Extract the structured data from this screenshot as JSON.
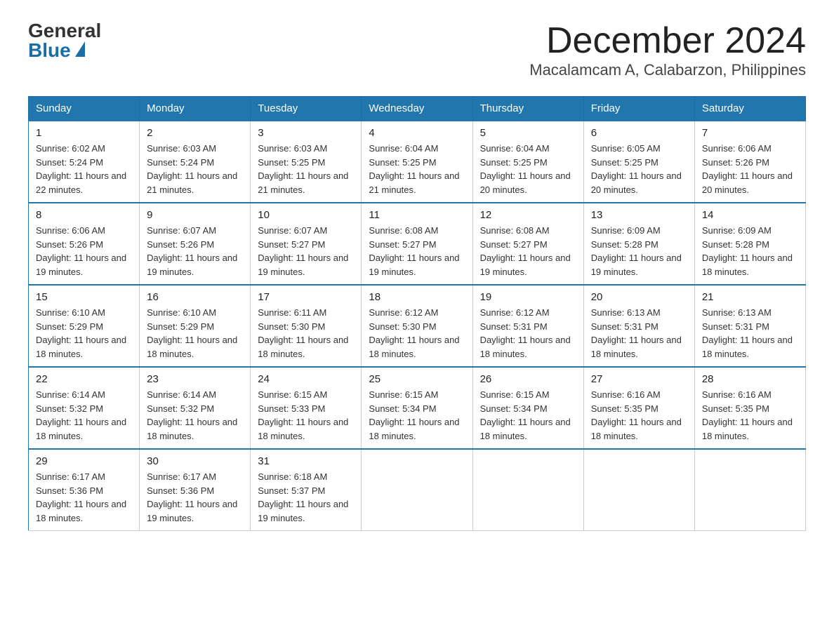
{
  "header": {
    "logo_general": "General",
    "logo_blue": "Blue",
    "month_title": "December 2024",
    "location": "Macalamcam A, Calabarzon, Philippines"
  },
  "weekdays": [
    "Sunday",
    "Monday",
    "Tuesday",
    "Wednesday",
    "Thursday",
    "Friday",
    "Saturday"
  ],
  "weeks": [
    [
      {
        "day": "1",
        "sunrise": "6:02 AM",
        "sunset": "5:24 PM",
        "daylight": "11 hours and 22 minutes."
      },
      {
        "day": "2",
        "sunrise": "6:03 AM",
        "sunset": "5:24 PM",
        "daylight": "11 hours and 21 minutes."
      },
      {
        "day": "3",
        "sunrise": "6:03 AM",
        "sunset": "5:25 PM",
        "daylight": "11 hours and 21 minutes."
      },
      {
        "day": "4",
        "sunrise": "6:04 AM",
        "sunset": "5:25 PM",
        "daylight": "11 hours and 21 minutes."
      },
      {
        "day": "5",
        "sunrise": "6:04 AM",
        "sunset": "5:25 PM",
        "daylight": "11 hours and 20 minutes."
      },
      {
        "day": "6",
        "sunrise": "6:05 AM",
        "sunset": "5:25 PM",
        "daylight": "11 hours and 20 minutes."
      },
      {
        "day": "7",
        "sunrise": "6:06 AM",
        "sunset": "5:26 PM",
        "daylight": "11 hours and 20 minutes."
      }
    ],
    [
      {
        "day": "8",
        "sunrise": "6:06 AM",
        "sunset": "5:26 PM",
        "daylight": "11 hours and 19 minutes."
      },
      {
        "day": "9",
        "sunrise": "6:07 AM",
        "sunset": "5:26 PM",
        "daylight": "11 hours and 19 minutes."
      },
      {
        "day": "10",
        "sunrise": "6:07 AM",
        "sunset": "5:27 PM",
        "daylight": "11 hours and 19 minutes."
      },
      {
        "day": "11",
        "sunrise": "6:08 AM",
        "sunset": "5:27 PM",
        "daylight": "11 hours and 19 minutes."
      },
      {
        "day": "12",
        "sunrise": "6:08 AM",
        "sunset": "5:27 PM",
        "daylight": "11 hours and 19 minutes."
      },
      {
        "day": "13",
        "sunrise": "6:09 AM",
        "sunset": "5:28 PM",
        "daylight": "11 hours and 19 minutes."
      },
      {
        "day": "14",
        "sunrise": "6:09 AM",
        "sunset": "5:28 PM",
        "daylight": "11 hours and 18 minutes."
      }
    ],
    [
      {
        "day": "15",
        "sunrise": "6:10 AM",
        "sunset": "5:29 PM",
        "daylight": "11 hours and 18 minutes."
      },
      {
        "day": "16",
        "sunrise": "6:10 AM",
        "sunset": "5:29 PM",
        "daylight": "11 hours and 18 minutes."
      },
      {
        "day": "17",
        "sunrise": "6:11 AM",
        "sunset": "5:30 PM",
        "daylight": "11 hours and 18 minutes."
      },
      {
        "day": "18",
        "sunrise": "6:12 AM",
        "sunset": "5:30 PM",
        "daylight": "11 hours and 18 minutes."
      },
      {
        "day": "19",
        "sunrise": "6:12 AM",
        "sunset": "5:31 PM",
        "daylight": "11 hours and 18 minutes."
      },
      {
        "day": "20",
        "sunrise": "6:13 AM",
        "sunset": "5:31 PM",
        "daylight": "11 hours and 18 minutes."
      },
      {
        "day": "21",
        "sunrise": "6:13 AM",
        "sunset": "5:31 PM",
        "daylight": "11 hours and 18 minutes."
      }
    ],
    [
      {
        "day": "22",
        "sunrise": "6:14 AM",
        "sunset": "5:32 PM",
        "daylight": "11 hours and 18 minutes."
      },
      {
        "day": "23",
        "sunrise": "6:14 AM",
        "sunset": "5:32 PM",
        "daylight": "11 hours and 18 minutes."
      },
      {
        "day": "24",
        "sunrise": "6:15 AM",
        "sunset": "5:33 PM",
        "daylight": "11 hours and 18 minutes."
      },
      {
        "day": "25",
        "sunrise": "6:15 AM",
        "sunset": "5:34 PM",
        "daylight": "11 hours and 18 minutes."
      },
      {
        "day": "26",
        "sunrise": "6:15 AM",
        "sunset": "5:34 PM",
        "daylight": "11 hours and 18 minutes."
      },
      {
        "day": "27",
        "sunrise": "6:16 AM",
        "sunset": "5:35 PM",
        "daylight": "11 hours and 18 minutes."
      },
      {
        "day": "28",
        "sunrise": "6:16 AM",
        "sunset": "5:35 PM",
        "daylight": "11 hours and 18 minutes."
      }
    ],
    [
      {
        "day": "29",
        "sunrise": "6:17 AM",
        "sunset": "5:36 PM",
        "daylight": "11 hours and 18 minutes."
      },
      {
        "day": "30",
        "sunrise": "6:17 AM",
        "sunset": "5:36 PM",
        "daylight": "11 hours and 19 minutes."
      },
      {
        "day": "31",
        "sunrise": "6:18 AM",
        "sunset": "5:37 PM",
        "daylight": "11 hours and 19 minutes."
      },
      null,
      null,
      null,
      null
    ]
  ],
  "labels": {
    "sunrise": "Sunrise:",
    "sunset": "Sunset:",
    "daylight": "Daylight:"
  }
}
